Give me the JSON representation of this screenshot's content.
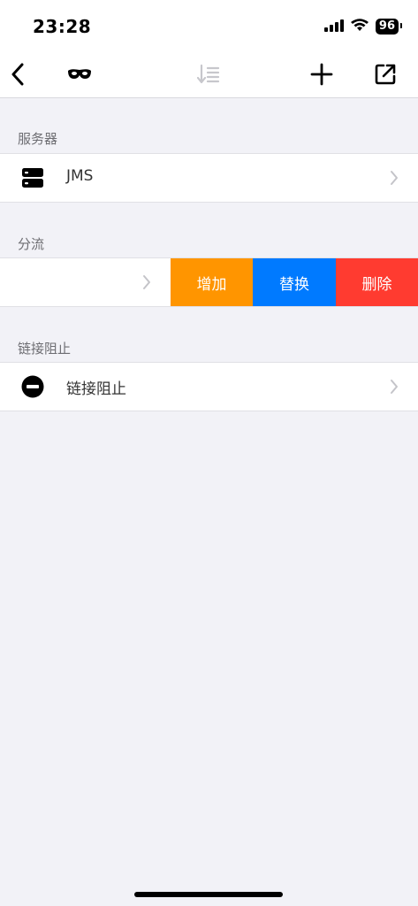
{
  "status": {
    "time": "23:28",
    "battery": "96"
  },
  "navbar": {
    "back_icon": "chevron-left-icon",
    "mask_icon": "mask-icon",
    "sort_icon": "sort-icon",
    "add_icon": "plus-icon",
    "share_icon": "external-link-icon"
  },
  "sections": {
    "server": {
      "header": "服务器",
      "item_label": "JMS",
      "icon": "server-icon"
    },
    "split": {
      "header": "分流",
      "actions": {
        "add": "增加",
        "replace": "替换",
        "delete": "删除"
      },
      "colors": {
        "add": "#ff9500",
        "replace": "#007aff",
        "delete": "#ff3b30"
      }
    },
    "block": {
      "header": "链接阻止",
      "item_label": "链接阻止",
      "icon": "block-icon"
    }
  }
}
